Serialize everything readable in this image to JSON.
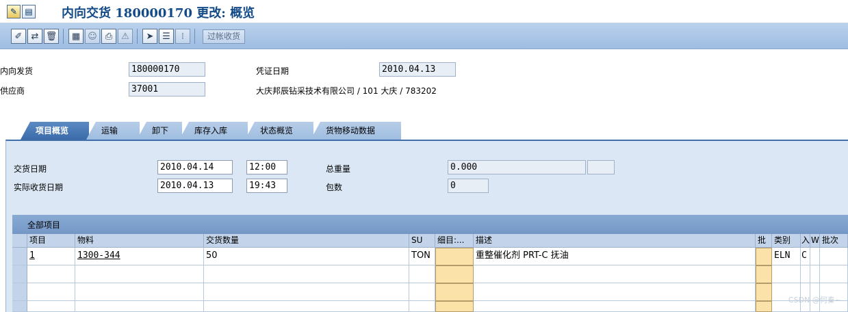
{
  "title": {
    "text": "内向交货 180000170 更改: 概览"
  },
  "toolbar": {
    "post_goods_receipt_label": "过帐收货",
    "icons": [
      "edit-icon",
      "display-change-icon",
      "delete-icon",
      "header-details-icon",
      "partner-icon",
      "print-icon",
      "output-icon",
      "item-details-icon",
      "batch-icon",
      "serial-icon"
    ]
  },
  "header": {
    "inbound_delivery_label": "内向发货",
    "inbound_delivery_value": "180000170",
    "doc_date_label": "凭证日期",
    "doc_date_value": "2010.04.13",
    "vendor_label": "供应商",
    "vendor_value": "37001",
    "vendor_desc": "大庆邦辰钻采技术有限公司 / 101 大庆 / 783202"
  },
  "tabs": [
    {
      "label": "项目概览",
      "active": true
    },
    {
      "label": "运输",
      "active": false
    },
    {
      "label": "卸下",
      "active": false
    },
    {
      "label": "库存入库",
      "active": false
    },
    {
      "label": "状态概览",
      "active": false
    },
    {
      "label": "货物移动数据",
      "active": false
    }
  ],
  "overview": {
    "delivery_date_label": "交货日期",
    "delivery_date_value": "2010.04.14",
    "delivery_time_value": "12:00",
    "total_weight_label": "总重量",
    "total_weight_value": "0.000",
    "actual_gr_date_label": "实际收货日期",
    "actual_gr_date_value": "2010.04.13",
    "actual_gr_time_value": "19:43",
    "packages_label": "包数",
    "packages_value": "0"
  },
  "table": {
    "title": "全部项目",
    "columns": [
      "项目",
      "物料",
      "交货数量",
      "SU",
      "细目:...",
      "描述",
      "批",
      "类别",
      "入",
      "W",
      "批次"
    ],
    "rows": [
      {
        "item": "1",
        "material": "1300-344",
        "qty": "50",
        "su": "TON",
        "detail": "",
        "desc": "重整催化剂 PRT-C 抚油",
        "batch_flag": "",
        "category": "ELN",
        "in": "C",
        "w": "",
        "batch": ""
      }
    ]
  },
  "watermark": "CSDN @何秦~"
}
